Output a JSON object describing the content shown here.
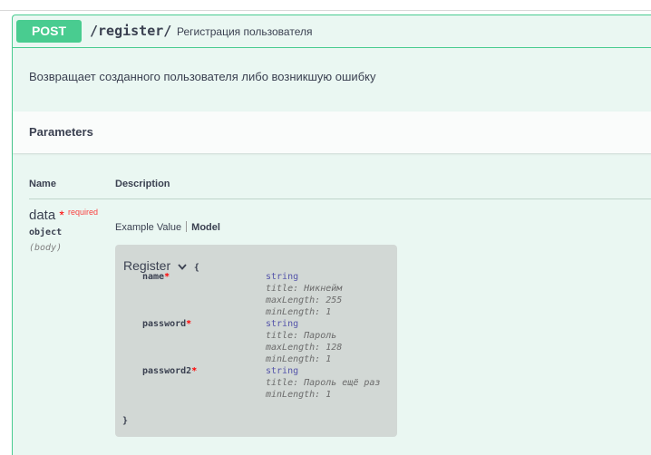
{
  "operation": {
    "method": "POST",
    "path": "/register/",
    "summary": "Регистрация пользователя",
    "description": "Возвращает созданного пользователя либо возникшую ошибку"
  },
  "parameters": {
    "section_title": "Parameters",
    "columns": {
      "name": "Name",
      "description": "Description"
    },
    "param": {
      "name": "data",
      "required_star": "*",
      "required_label": "required",
      "type": "object",
      "in": "(body)"
    },
    "tabs": {
      "example_value": "Example Value",
      "model": "Model"
    },
    "model": {
      "title": "Register",
      "open_brace": "{",
      "close_brace": "}",
      "properties": [
        {
          "name": "name",
          "star": "*",
          "type": "string",
          "meta": [
            "title: Никнейм",
            "maxLength: 255",
            "minLength: 1"
          ]
        },
        {
          "name": "password",
          "star": "*",
          "type": "string",
          "meta": [
            "title: Пароль",
            "maxLength: 128",
            "minLength: 1"
          ]
        },
        {
          "name": "password2",
          "star": "*",
          "type": "string",
          "meta": [
            "title: Пароль ещё раз",
            "minLength: 1"
          ]
        }
      ]
    }
  },
  "colors": {
    "post": "#49cc90",
    "background": "#eaf7f2",
    "required": "#ff0000"
  },
  "icons": {
    "model_toggle": "chevron-down-icon"
  }
}
